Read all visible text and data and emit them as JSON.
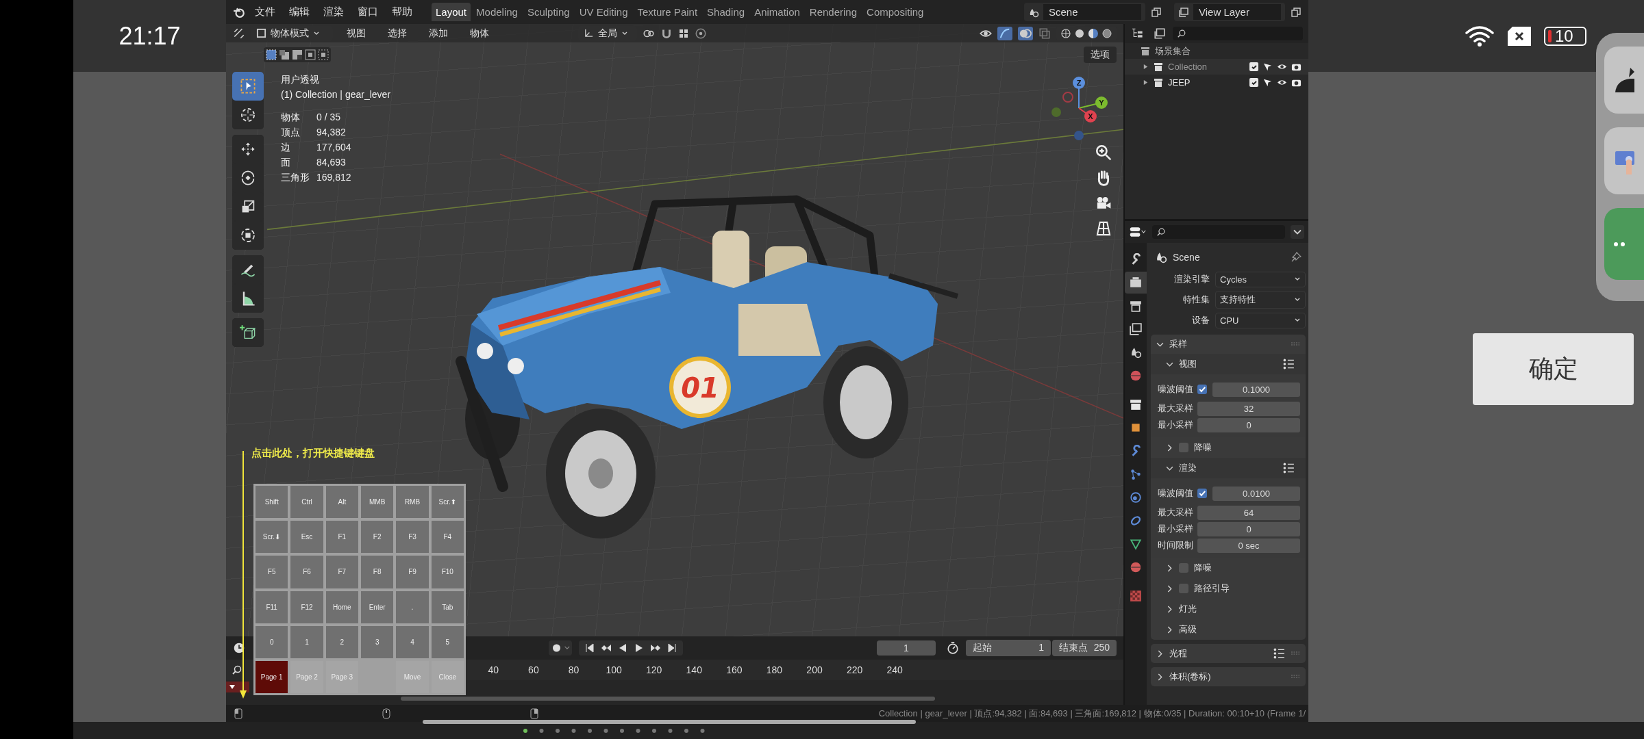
{
  "phone": {
    "time": "21:17",
    "battery": "10",
    "confirm": "确定"
  },
  "menu": [
    "文件",
    "编辑",
    "渲染",
    "窗口",
    "帮助"
  ],
  "workspaces": [
    {
      "label": "Layout",
      "selected": true
    },
    {
      "label": "Modeling",
      "selected": false
    },
    {
      "label": "Sculpting",
      "selected": false
    },
    {
      "label": "UV Editing",
      "selected": false
    },
    {
      "label": "Texture Paint",
      "selected": false
    },
    {
      "label": "Shading",
      "selected": false
    },
    {
      "label": "Animation",
      "selected": false
    },
    {
      "label": "Rendering",
      "selected": false
    },
    {
      "label": "Compositing",
      "selected": false
    }
  ],
  "scene": "Scene",
  "view_layer": "View Layer",
  "viewport": {
    "mode": "物体模式",
    "menus": [
      "视图",
      "选择",
      "添加",
      "物体"
    ],
    "orientation": "全局",
    "options": "选项",
    "view_name": "用户透视",
    "context": "(1) Collection | gear_lever",
    "stats": [
      {
        "label": "物体",
        "value": "0 / 35"
      },
      {
        "label": "顶点",
        "value": "94,382"
      },
      {
        "label": "边",
        "value": "177,604"
      },
      {
        "label": "面",
        "value": "84,693"
      },
      {
        "label": "三角形",
        "value": "169,812"
      }
    ],
    "axes": [
      "Z",
      "Y",
      "X"
    ],
    "decal": "01"
  },
  "hint": "点击此处，打开快捷键键盘",
  "keyboard": {
    "keys": [
      "Shift",
      "Ctrl",
      "Alt",
      "MMB",
      "RMB",
      "Scr.⬆",
      "Scr.⬇",
      "Esc",
      "F1",
      "F2",
      "F3",
      "F4",
      "F5",
      "F6",
      "F7",
      "F8",
      "F9",
      "F10",
      "F11",
      "F12",
      "Home",
      "Enter",
      ".",
      "Tab",
      "0",
      "1",
      "2",
      "3",
      "4",
      "5"
    ],
    "pages": [
      {
        "label": "Page 1",
        "selected": true
      },
      {
        "label": "Page 2",
        "selected": false
      },
      {
        "label": "Page 3",
        "selected": false
      }
    ],
    "actions": [
      "Move",
      "Close"
    ]
  },
  "outliner": {
    "root": "场景集合",
    "items": [
      {
        "name": "Collection",
        "checked": true,
        "dimmed": true
      },
      {
        "name": "JEEP",
        "checked": true,
        "dimmed": false
      }
    ]
  },
  "properties": {
    "tabs": [
      {
        "kind": "tool",
        "selected": false
      },
      {
        "kind": "render",
        "selected": true
      },
      {
        "kind": "output",
        "selected": false
      },
      {
        "kind": "view_layer",
        "selected": false
      },
      {
        "kind": "scene",
        "selected": false
      },
      {
        "kind": "world",
        "selected": false
      },
      {
        "kind": "collection",
        "selected": false
      },
      {
        "kind": "object",
        "selected": false
      },
      {
        "kind": "modifier",
        "selected": false
      },
      {
        "kind": "particles",
        "selected": false
      },
      {
        "kind": "physics",
        "selected": false
      },
      {
        "kind": "constraint",
        "selected": false
      },
      {
        "kind": "data",
        "selected": false
      },
      {
        "kind": "material",
        "selected": false
      },
      {
        "kind": "texture",
        "selected": false
      }
    ],
    "title": "Scene",
    "fields": [
      {
        "label": "渲染引擎",
        "value": "Cycles"
      },
      {
        "label": "特性集",
        "value": "支持特性"
      },
      {
        "label": "设备",
        "value": "CPU"
      }
    ],
    "sampling": {
      "title": "采样",
      "expanded": true,
      "sections": [
        {
          "title": "视图",
          "expanded": true,
          "rows": [
            {
              "kind": "check",
              "label": "噪波阈值",
              "checked": true,
              "value": "0.1000"
            },
            {
              "kind": "number",
              "label": "最大采样",
              "value": "32"
            },
            {
              "kind": "number",
              "label": "最小采样",
              "value": "0"
            }
          ],
          "toggle": {
            "label": "降噪",
            "checked": false,
            "expanded": false
          }
        },
        {
          "title": "渲染",
          "expanded": true,
          "rows": [
            {
              "kind": "check",
              "label": "噪波阈值",
              "checked": true,
              "value": "0.0100"
            },
            {
              "kind": "number",
              "label": "最大采样",
              "value": "64"
            },
            {
              "kind": "number",
              "label": "最小采样",
              "value": "0"
            },
            {
              "kind": "number",
              "label": "时间限制",
              "value": "0 sec"
            }
          ],
          "toggle": {
            "label": "降噪",
            "checked": false,
            "expanded": false
          }
        }
      ],
      "subpanels": [
        {
          "kind": "checkbox",
          "label": "路径引导",
          "checked": false,
          "expanded": false
        },
        {
          "kind": "plain",
          "label": "灯光",
          "expanded": false
        },
        {
          "kind": "plain",
          "label": "高级",
          "expanded": false
        }
      ]
    },
    "panels": [
      {
        "title": "光程",
        "expanded": false,
        "presets": true
      },
      {
        "title": "体积(卷标)",
        "expanded": false,
        "presets": false
      }
    ]
  },
  "timeline": {
    "frame": "1",
    "start_label": "起始",
    "start": "1",
    "end_label": "结束点",
    "end": "250",
    "ticks": [
      "40",
      "60",
      "80",
      "100",
      "120",
      "140",
      "160",
      "180",
      "200",
      "220",
      "240"
    ]
  },
  "status_bar": "Collection | gear_lever | 顶点:94,382 | 面:84,693 | 三角面:169,812 | 物体:0/35 | Duration: 00:10+10 (Frame 1/"
}
